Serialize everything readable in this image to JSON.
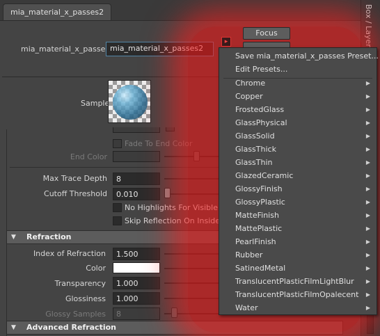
{
  "tab": {
    "label": "mia_material_x_passes2"
  },
  "side_panel": {
    "label": "Box / Layer E"
  },
  "node": {
    "label": "mia_material_x_passes:",
    "value": "mia_material_x_passes2"
  },
  "buttons": {
    "focus": "Focus"
  },
  "sample": {
    "label": "Sample"
  },
  "reflection": {
    "fade_to_end_color": "Fade To End Color",
    "end_color": "End Color",
    "max_trace_depth_label": "Max Trace Depth",
    "max_trace_depth": "8",
    "cutoff_threshold_label": "Cutoff Threshold",
    "cutoff_threshold": "0.010",
    "no_highlights": "No Highlights For Visible Are",
    "skip_reflection": "Skip Reflection On Inside"
  },
  "refraction": {
    "title": "Refraction",
    "ior_label": "Index of Refraction",
    "ior": "1.500",
    "color_label": "Color",
    "color_value": "#ffffff",
    "transparency_label": "Transparency",
    "transparency": "1.000",
    "glossiness_label": "Glossiness",
    "glossiness": "1.000",
    "glossy_samples_label": "Glossy Samples",
    "glossy_samples": "8"
  },
  "advanced_refraction": {
    "title": "Advanced Refraction"
  },
  "preset_menu": {
    "actions": [
      "Save mia_material_x_passes Preset...",
      "Edit Presets..."
    ],
    "presets": [
      "Chrome",
      "Copper",
      "FrostedGlass",
      "GlassPhysical",
      "GlassSolid",
      "GlassThick",
      "GlassThin",
      "GlazedCeramic",
      "GlossyFinish",
      "GlossyPlastic",
      "MatteFinish",
      "MattePlastic",
      "PearlFinish",
      "Rubber",
      "SatinedMetal",
      "TranslucentPlasticFilmLightBlur",
      "TranslucentPlasticFilmOpalecent",
      "Water"
    ]
  },
  "colors": {
    "accent": "#5285a6",
    "highlight_glow": "#ff2020",
    "panel_bg": "#444444"
  }
}
